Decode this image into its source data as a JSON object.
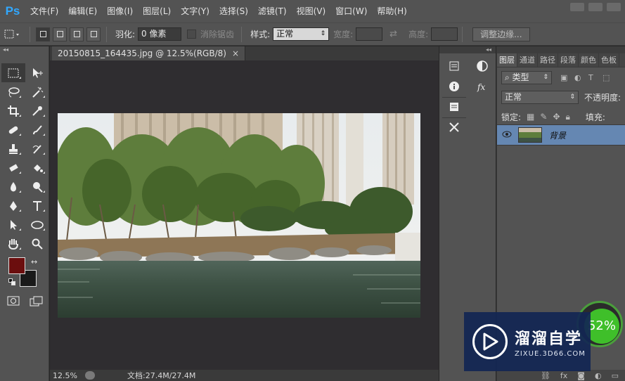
{
  "app": {
    "logo": "Ps"
  },
  "menu": [
    "文件(F)",
    "编辑(E)",
    "图像(I)",
    "图层(L)",
    "文字(Y)",
    "选择(S)",
    "滤镜(T)",
    "视图(V)",
    "窗口(W)",
    "帮助(H)"
  ],
  "options": {
    "feather_label": "羽化:",
    "feather_value": "0 像素",
    "antialias_label": "消除锯齿",
    "style_label": "样式:",
    "style_value": "正常",
    "width_label": "宽度:",
    "height_label": "高度:",
    "refine_edge_button": "调整边缘..."
  },
  "document": {
    "tab_title": "20150815_164435.jpg @ 12.5%(RGB/8)",
    "close_glyph": "×",
    "zoom": "12.5%",
    "doc_info": "文档:27.4M/27.4M"
  },
  "colors": {
    "foreground": "#6b0e0e",
    "background": "#1a1a1a",
    "accent": "#31a8ff",
    "layer_selected": "#6587b2"
  },
  "layers_panel": {
    "tabs": [
      "图层",
      "通道",
      "路径",
      "段落",
      "颜色",
      "色板"
    ],
    "filter_type": "类型",
    "blend_mode": "正常",
    "opacity_label": "不透明度:",
    "lock_label": "锁定:",
    "fill_label": "填充:",
    "layer_name": "背景"
  },
  "overlays": {
    "percent": "52%",
    "watermark_title": "溜溜自学",
    "watermark_url": "ZIXUE.3D66.COM"
  }
}
